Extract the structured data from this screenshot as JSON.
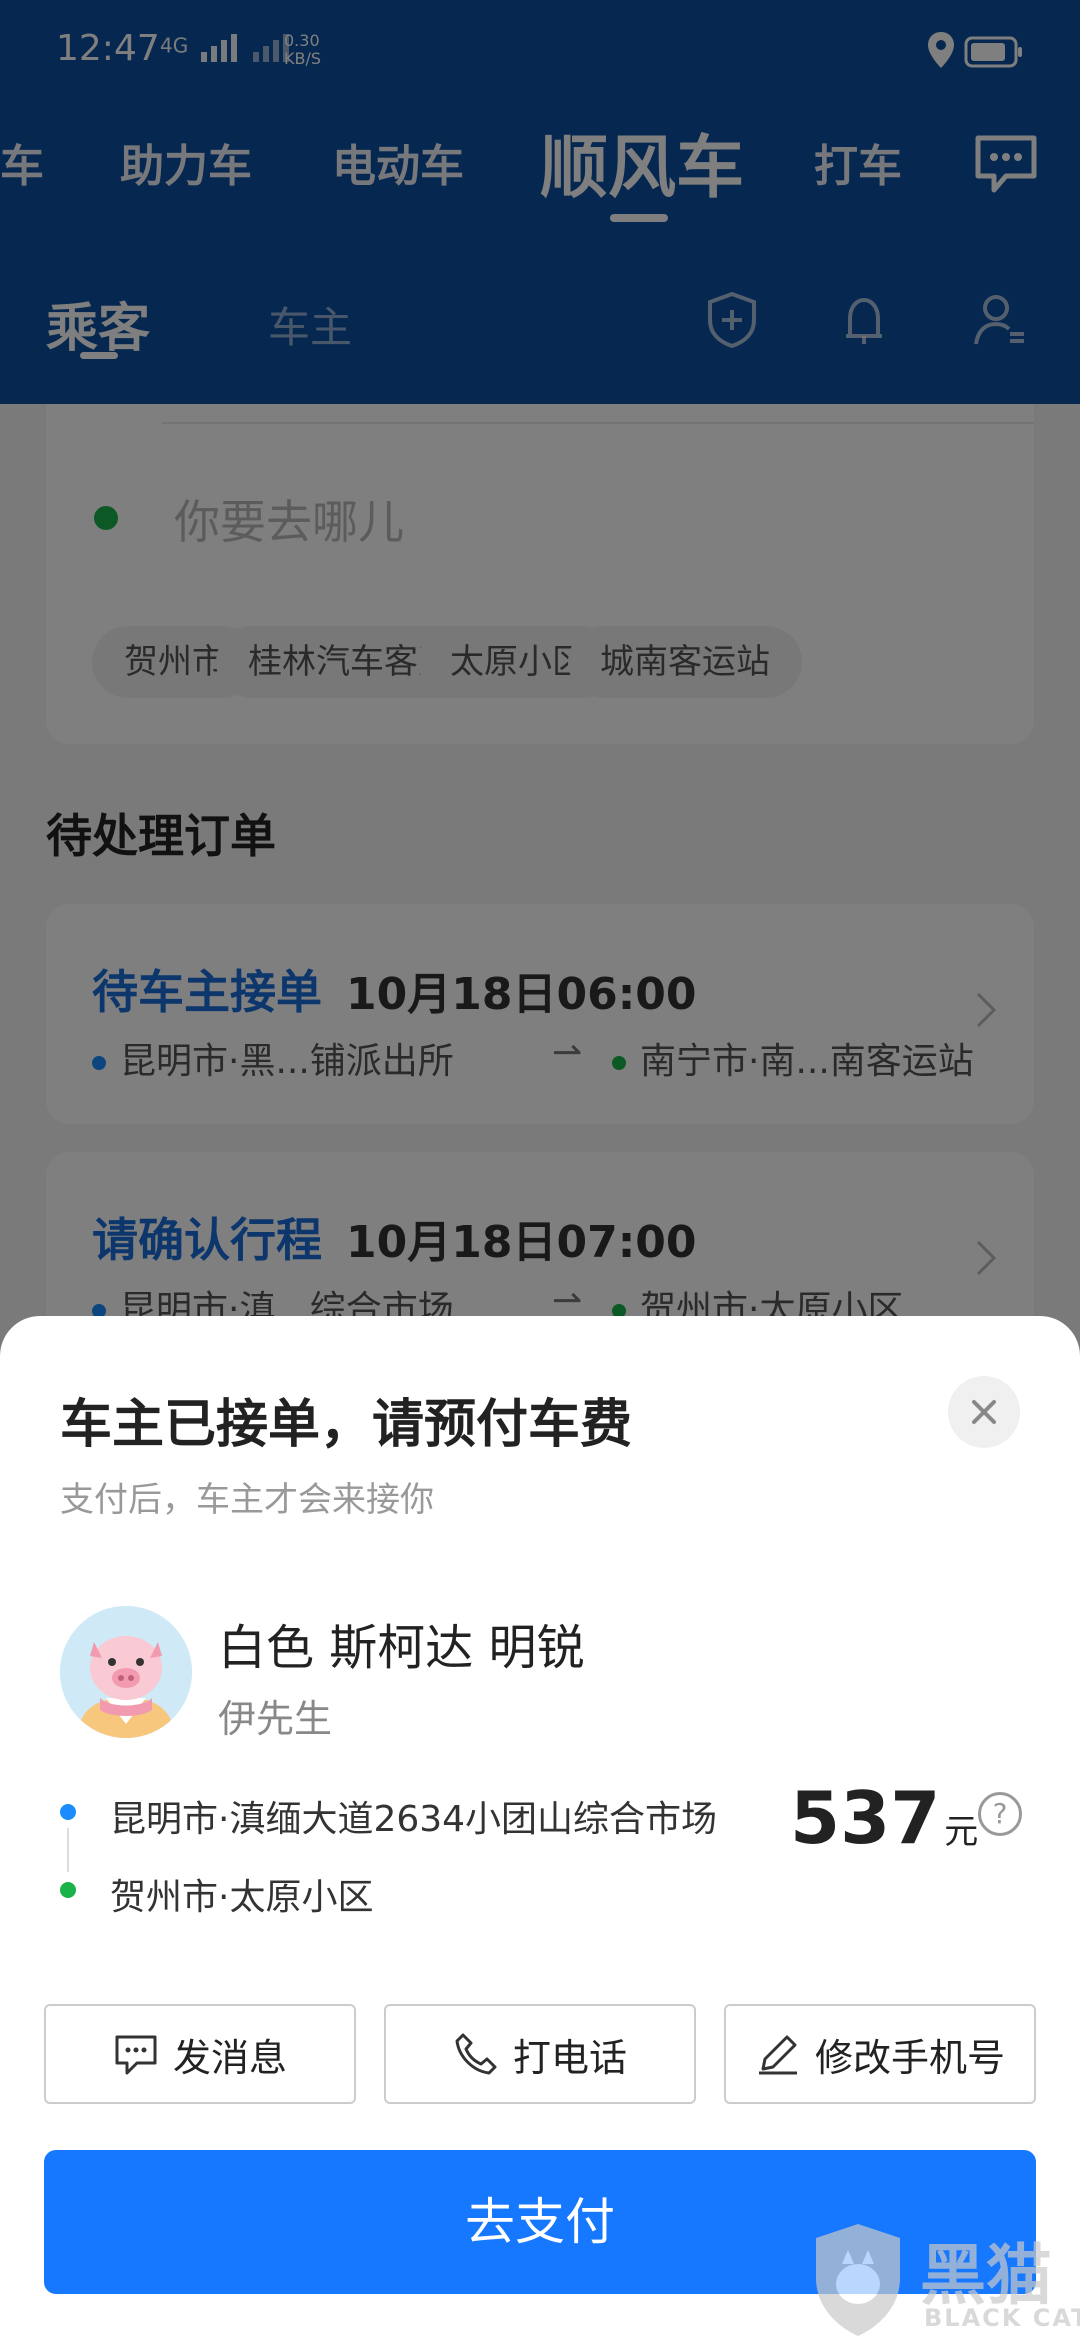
{
  "status_bar": {
    "time": "12:47",
    "network": "4G",
    "speed_value": "0.30",
    "speed_unit": "KB/S"
  },
  "mode_tabs": [
    {
      "label": "车"
    },
    {
      "label": "助力车"
    },
    {
      "label": "电动车"
    },
    {
      "label": "顺风车",
      "active": true
    },
    {
      "label": "打车"
    }
  ],
  "role_tabs": {
    "passenger": "乘客",
    "driver": "车主"
  },
  "search": {
    "placeholder": "你要去哪儿",
    "chips": [
      "贺州市",
      "桂林汽车客运...",
      "太原小区",
      "城南客运站"
    ]
  },
  "pending_section": {
    "title": "待处理订单",
    "orders": [
      {
        "status": "待车主接单",
        "time": "10月18日06:00",
        "from": "昆明市·黑...铺派出所",
        "to": "南宁市·南...南客运站"
      },
      {
        "status": "请确认行程",
        "time": "10月18日07:00",
        "from": "昆明市·滇...综合市场",
        "to": "贺州市·太原小区"
      }
    ]
  },
  "sheet": {
    "title": "车主已接单，请预付车费",
    "subtitle": "支付后，车主才会来接你",
    "car": "白色 斯柯达 明锐",
    "driver": "伊先生",
    "from": "昆明市·滇缅大道2634小团山综合市场",
    "to": "贺州市·太原小区",
    "price": "537",
    "price_unit": "元",
    "help": "?",
    "actions": {
      "message": "发消息",
      "call": "打电话",
      "edit_phone": "修改手机号"
    },
    "pay_label": "去支付"
  },
  "watermark": {
    "cn": "黑猫",
    "en": "BLACK CAT"
  },
  "colors": {
    "header": "#0d4f9f",
    "accent": "#1677ff",
    "status_blue": "#1a6fd8",
    "green": "#19b34a"
  }
}
